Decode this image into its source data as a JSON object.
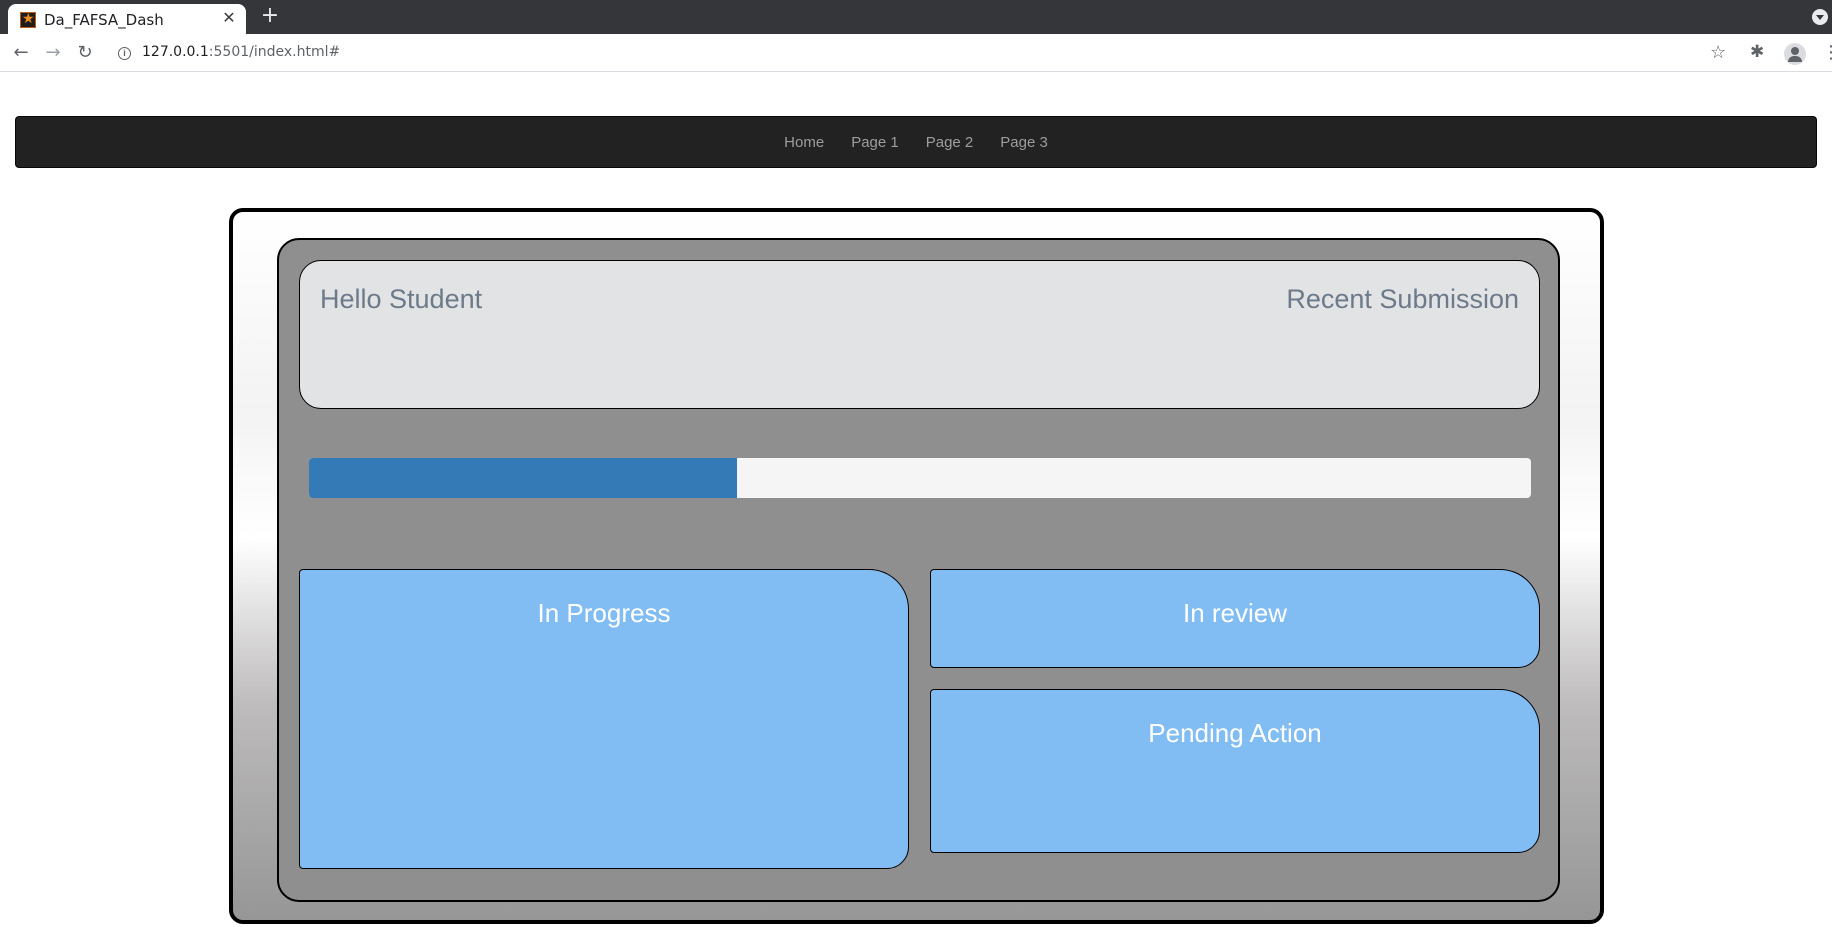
{
  "browser": {
    "tab_title": "Da_FAFSA_Dash",
    "tab_close": "✕",
    "new_tab": "+",
    "url_host": "127.0.0.1",
    "url_rest": ":5501/index.html#",
    "icons": {
      "favicon": "star-favicon-icon",
      "back": "arrow-left-icon",
      "forward": "arrow-right-icon",
      "reload": "reload-icon",
      "info": "info-icon",
      "bookmark": "star-icon",
      "extensions": "puzzle-icon",
      "profile": "profile-icon",
      "menu": "kebab-menu-icon"
    }
  },
  "navbar": {
    "links": [
      "Home",
      "Page 1",
      "Page 2",
      "Page 3"
    ]
  },
  "header": {
    "greeting": "Hello Student",
    "recent": "Recent Submission"
  },
  "progress": {
    "percent": 35,
    "color": "#337ab7"
  },
  "panels": {
    "in_progress": "In Progress",
    "in_review": "In review",
    "pending": "Pending Action"
  },
  "colors": {
    "navbar_bg": "#222222",
    "panel_bg": "#81bdf3",
    "inner_bg": "#8f8f8f",
    "header_bg": "#e2e3e5"
  }
}
